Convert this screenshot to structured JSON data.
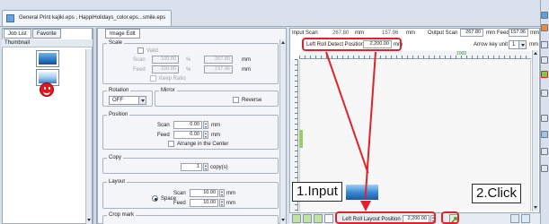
{
  "document_tab": {
    "title": "General Print kajiki.eps , HappiHolidays_color.eps...smile.eps"
  },
  "left_panel": {
    "tabs": [
      "Job List",
      "Favorite"
    ],
    "thumbnail_header": "Thumbnail"
  },
  "edit_panel": {
    "tab": "Image Edit",
    "scale": {
      "title": "Scale",
      "valid_label": "Valid",
      "scan_label": "Scan",
      "scan_value": "100.00",
      "scan_unit": "%",
      "scan_mm": "267.80",
      "scan_mm_unit": "mm",
      "feed_label": "Feed",
      "feed_value": "100.00",
      "feed_unit": "%",
      "feed_mm": "157.96",
      "feed_mm_unit": "mm",
      "keep_ratio_label": "Keep Ratio"
    },
    "rotation": {
      "title": "Rotation",
      "value": "OFF"
    },
    "mirror": {
      "title": "Mirror",
      "reverse_label": "Reverse"
    },
    "position": {
      "title": "Position",
      "scan_label": "Scan",
      "scan_value": "0.00",
      "feed_label": "Feed",
      "feed_value": "0.00",
      "unit": "mm",
      "arrange_center_label": "Arrange in the Center"
    },
    "copy": {
      "title": "Copy",
      "value": "1",
      "unit": "copy(s)"
    },
    "layout": {
      "title": "Layout",
      "space_label": "Space",
      "scan_label": "Scan",
      "scan_value": "10.00",
      "feed_label": "Feed",
      "feed_value": "10.00",
      "unit": "mm"
    },
    "crop_mark": {
      "title": "Crop mark"
    }
  },
  "layout_area": {
    "input_scan_label": "Input Scan",
    "input_scan_value": "267.80",
    "input_scan_unit": "mm",
    "input_feed_value": "157.96",
    "input_feed_unit": "mm",
    "output_scan_label": "Output Scan",
    "output_scan_value": "267.80",
    "output_scan_unit": "mm",
    "output_feed_label": "Feed",
    "output_feed_value": "157.96",
    "output_feed_unit": "mm",
    "left_roll_detect_label": "Left Roll Detect Position",
    "left_roll_detect_value": "2,200.00",
    "left_roll_detect_unit": "mm",
    "arrow_key_unit_label": "Arrow key unit",
    "arrow_key_unit_value": "1",
    "arrow_key_unit_suffix": "mm",
    "ruler_mark": "1000",
    "left_roll_layout_label": "Left Roll Layout Position",
    "left_roll_layout_value": "2,200.00"
  },
  "annotations": {
    "input_label": "1.Input",
    "click_label": "2.Click",
    "color": "#e2222a"
  },
  "colors": {
    "panel_bg": "#d9e2ec",
    "highlight_red": "#e2222a",
    "apply_green": "#3a9a2f"
  }
}
